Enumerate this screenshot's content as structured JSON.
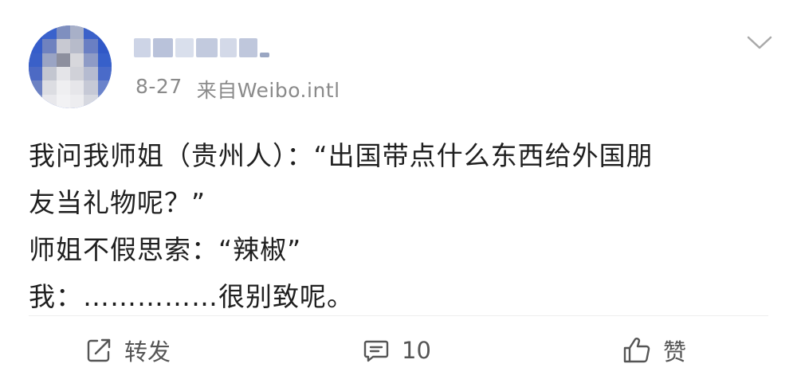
{
  "post": {
    "author": {
      "username_redacted": true
    },
    "meta": {
      "date": "8-27",
      "source": "来自Weibo.intl"
    },
    "text_lines": [
      "我问我师姐（贵州人）：“出国带点什么东西给外国朋",
      "友当礼物呢？”",
      "师姐不假思索：“辣椒”",
      "我：……………很别致呢。"
    ]
  },
  "actions": {
    "repost_label": "转发",
    "comment_count": "10",
    "like_label": "赞"
  },
  "icons": {
    "menu": "chevron-down-icon",
    "repost": "repost-icon",
    "comment": "comment-icon",
    "like": "thumbs-up-icon"
  },
  "colors": {
    "meta_text": "#8a8a8a",
    "action_text": "#555555"
  }
}
